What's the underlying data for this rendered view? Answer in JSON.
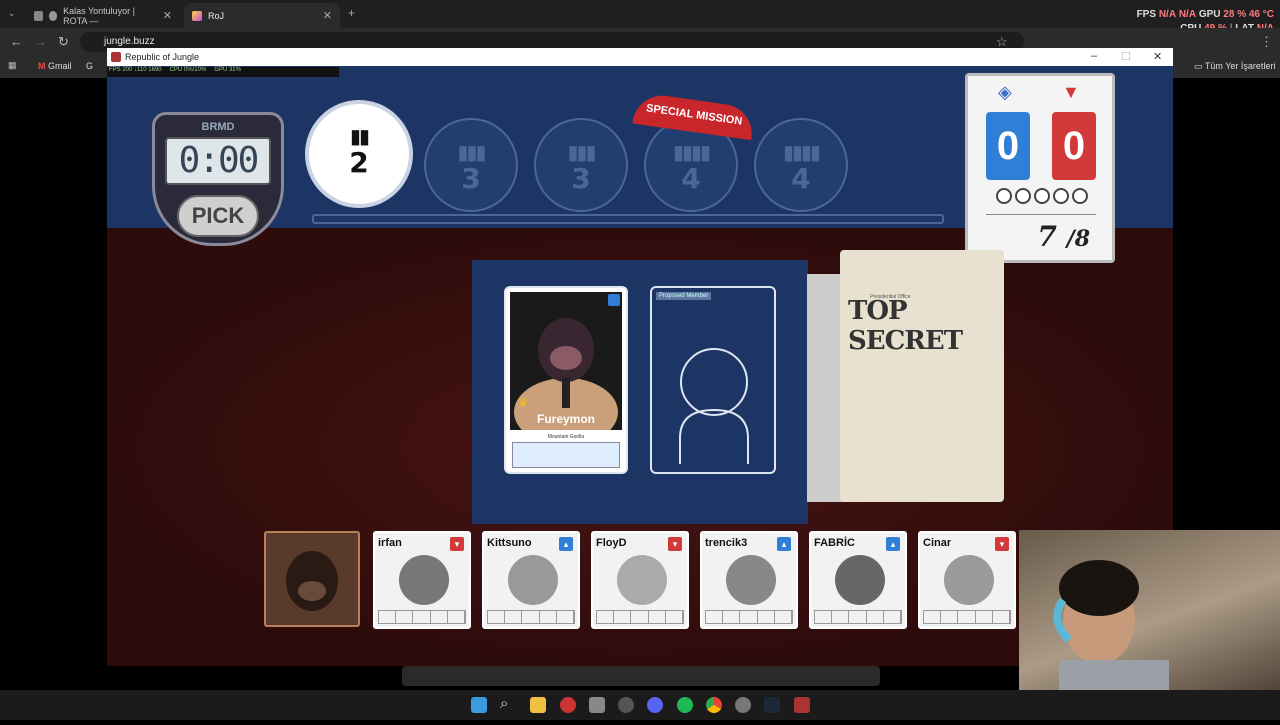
{
  "browser": {
    "tabs": [
      {
        "title": "Kalas Yontuluyor | ROTA —",
        "active": false
      },
      {
        "title": "RoJ",
        "active": true
      }
    ],
    "new_tab_label": "+",
    "url": "jungle.buzz",
    "bookmarks": [
      {
        "label": "Gmail"
      },
      {
        "label": "G"
      }
    ],
    "all_bookmarks_label": "Tüm Yer İşaretleri"
  },
  "overlay": {
    "fps_label": "FPS",
    "fps_value": "N/A",
    "fps_value2": "N/A",
    "gpu_label": "GPU",
    "gpu_value": "28 %",
    "gpu_temp": "46 °C",
    "cpu_label": "CPU",
    "cpu_value": "49 %",
    "lat_label": "LAT",
    "lat_value": "N/A"
  },
  "game_window": {
    "title": "Republic of Jungle",
    "perf": {
      "fps": "FPS 200 ↓110 1690",
      "cpu": "CPU 0%/10%",
      "gpu": "GPU 31%"
    }
  },
  "timer": {
    "label": "BRMD",
    "display": "0:00",
    "pick_label": "PICK"
  },
  "missions": [
    {
      "size": "2",
      "current": true,
      "special": false
    },
    {
      "size": "3",
      "current": false,
      "special": false
    },
    {
      "size": "3",
      "current": false,
      "special": false
    },
    {
      "size": "4",
      "current": false,
      "special": true
    },
    {
      "size": "4",
      "current": false,
      "special": false
    }
  ],
  "special_mission_label": "SPECIAL MISSION",
  "score": {
    "blue": "0",
    "red": "0",
    "round_current": "7",
    "round_total": "/8",
    "result_slots": 5
  },
  "selected_card": {
    "name": "Fureymon",
    "role": "Mountain Gorilla"
  },
  "proposed_card": {
    "header": "Proposed Member"
  },
  "dossier": {
    "office_label": "Presidential Office",
    "title": "TOP SECRET"
  },
  "players": [
    {
      "name": "irfan",
      "team": "red"
    },
    {
      "name": "Kittsuno",
      "team": "blue"
    },
    {
      "name": "FloyD",
      "team": "red"
    },
    {
      "name": "trencik3",
      "team": "blue"
    },
    {
      "name": "FABRİC",
      "team": "blue"
    },
    {
      "name": "Cinar",
      "team": "red"
    }
  ],
  "colors": {
    "blue_team": "#2f7fd6",
    "red_team": "#d23a3a",
    "board_blue": "#1c3565",
    "board_red": "#3a0f0f"
  }
}
